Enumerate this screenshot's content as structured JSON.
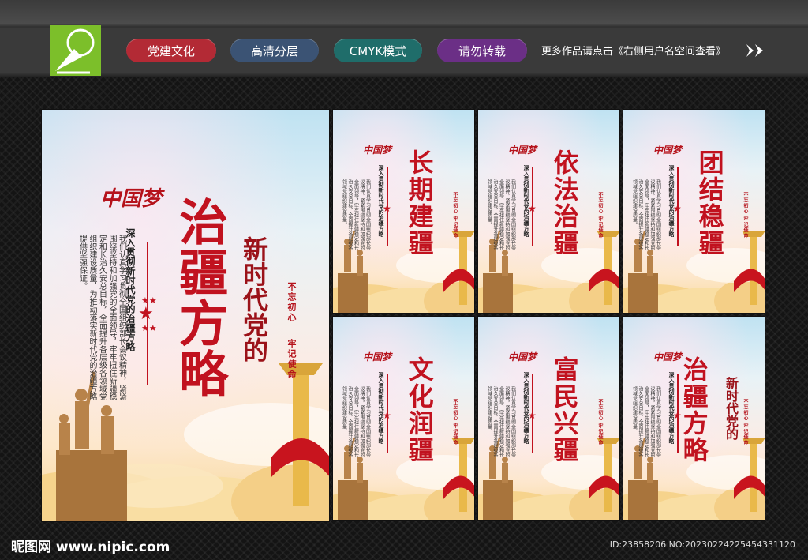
{
  "topbar": {
    "tags": [
      {
        "label": "党建文化",
        "color": "#b32a35"
      },
      {
        "label": "高清分层",
        "color": "#3b5374"
      },
      {
        "label": "CMYK模式",
        "color": "#1f6d6a"
      },
      {
        "label": "请勿转载",
        "color": "#6b2f86"
      }
    ],
    "notice": "更多作品请点击《右侧用户名空间查看》",
    "arrow_icon": "double-chevron-right-icon"
  },
  "main_poster": {
    "brand": "中国梦",
    "title": "治疆方略",
    "subtitle": "新时代党的",
    "heading_line": "深入贯彻新时代党的治疆方略",
    "body": "我们认真学习贯彻全国组织部长会议精神，紧紧围绕坚持和加强党的全面领导，牢牢扭住新疆稳定和长治久安总目标，全面提升各层级各领域党组织建设质量，为推动落实新时代党的治疆方略提供坚强保证。",
    "slogan_a": "不忘初心",
    "slogan_b": "牢记使命"
  },
  "small_posters": [
    {
      "title": "长期建疆",
      "brand": "中国梦",
      "heading_line": "深入贯彻新时代党的治疆方略",
      "slogan": "不忘初心 牢记使命"
    },
    {
      "title": "依法治疆",
      "brand": "中国梦",
      "heading_line": "深入贯彻新时代党的治疆方略",
      "slogan": "不忘初心 牢记使命"
    },
    {
      "title": "团结稳疆",
      "brand": "中国梦",
      "heading_line": "深入贯彻新时代党的治疆方略",
      "slogan": "不忘初心 牢记使命"
    },
    {
      "title": "文化润疆",
      "brand": "中国梦",
      "heading_line": "深入贯彻新时代党的治疆方略",
      "slogan": "不忘初心 牢记使命"
    },
    {
      "title": "富民兴疆",
      "brand": "中国梦",
      "heading_line": "深入贯彻新时代党的治疆方略",
      "slogan": "不忘初心 牢记使命"
    },
    {
      "title": "治疆方略",
      "subtitle": "新时代党的",
      "brand": "中国梦",
      "heading_line": "深入贯彻新时代党的治疆方略",
      "slogan": "不忘初心 牢记使命"
    }
  ],
  "small_body": "我们认真学习贯彻全国组织部长会议精神，紧紧围绕坚持和加强党的全面领导，牢牢扭住新疆稳定和长治久安总目标，全面提升各层级各领域党组织建设质量。",
  "footer": {
    "brand": "昵图网 www.nipic.com",
    "id": "ID:23858206 NO:20230224225454331120"
  },
  "colors": {
    "accent_red": "#c1121f",
    "logo_green": "#7cbf2a"
  }
}
